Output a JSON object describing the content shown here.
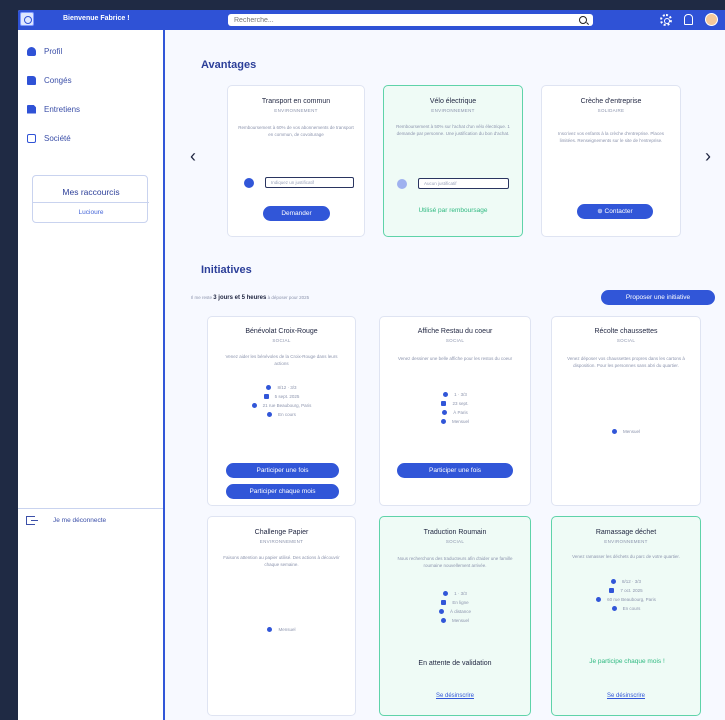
{
  "header": {
    "welcome": "Bienvenue Fabrice !",
    "search_placeholder": "Recherche...",
    "brand_color": "#2f52d6"
  },
  "sidebar": {
    "items": [
      {
        "label": "Profil",
        "icon": "user-icon"
      },
      {
        "label": "Congés",
        "icon": "calendar-icon"
      },
      {
        "label": "Entretiens",
        "icon": "document-icon"
      },
      {
        "label": "Société",
        "icon": "organization-icon"
      }
    ],
    "shortcuts_title": "Mes raccourcis",
    "shortcuts_link": "Lucioure",
    "logout": "Je me déconnecte"
  },
  "advantages": {
    "title": "Avantages",
    "cards": [
      {
        "title": "Transport en commun",
        "subtitle": "ENVIRONNEMENT",
        "desc": "Remboursement à 60% de vos abonnements de transport en commun, de covoiturage",
        "input_placeholder": "Indiquez un justificatif",
        "button": "Demander",
        "highlighted": false
      },
      {
        "title": "Vélo électrique",
        "subtitle": "ENVIRONNEMENT",
        "desc": "Remboursement à 50% sur l'achat d'un vélo électrique. 1 demande par personne. Une justification du bon d'achat.",
        "input_placeholder": "Aucun justificatif",
        "status": "Utilisé par remboursage",
        "highlighted": true
      },
      {
        "title": "Crèche d'entreprise",
        "subtitle": "SOLIDAIRE",
        "desc": "Inscrivez vos enfants à la crèche d'entreprise. Places limitées. Renseignements sur le site de l'entreprise.",
        "button": "Contacter",
        "highlighted": false
      }
    ]
  },
  "initiatives": {
    "title": "Initiatives",
    "info_prefix": "Il me reste",
    "info_bold": "3 jours et 5 heures",
    "info_suffix": "à déposer pour 2025",
    "propose_button": "Proposer une initiative",
    "cards": [
      {
        "title": "Bénévolat Croix-Rouge",
        "subtitle": "SOCIAL",
        "desc": "Venez aider les bénévoles de la Croix-Rouge dans leurs actions",
        "meta": [
          "8/12 · 3/3",
          "5 sept. 2025",
          "21 rue Beaubourg, Paris",
          "En cours"
        ],
        "buttons": [
          "Participer une fois",
          "Participer chaque mois"
        ],
        "highlighted": false
      },
      {
        "title": "Affiche Restau du coeur",
        "subtitle": "SOCIAL",
        "desc": "Venez dessiner une belle affiche pour les restos du coeur",
        "meta": [
          "1 · 3/3",
          "23 sept.",
          "À Paris",
          "Mensuel"
        ],
        "buttons": [
          "Participer une fois"
        ],
        "highlighted": false
      },
      {
        "title": "Récolte chaussettes",
        "subtitle": "SOCIAL",
        "desc": "Venez déposer vos chaussettes propres dans les cartons à disposition. Pour les personnes sans abri du quartier.",
        "meta": [
          "Mensuel"
        ],
        "buttons": [],
        "highlighted": false
      },
      {
        "title": "Challenge Papier",
        "subtitle": "ENVIRONNEMENT",
        "desc": "Faisons attention au papier utilisé. Des actions à découvrir chaque semaine.",
        "meta": [
          "Mensuel"
        ],
        "buttons": [],
        "highlighted": false
      },
      {
        "title": "Traduction Roumain",
        "subtitle": "SOCIAL",
        "desc": "Nous recherchons des traducteurs afin d'aider une famille roumaine nouvellement arrivée.",
        "meta": [
          "1 · 3/3",
          "En ligne",
          "À distance",
          "Mensuel"
        ],
        "wait": "En attente de validation",
        "link": "Se désinscrire",
        "highlighted": true
      },
      {
        "title": "Ramassage déchet",
        "subtitle": "ENVIRONNEMENT",
        "desc": "Venez ramasser les déchets du parc de votre quartier.",
        "meta": [
          "8/12 · 3/3",
          "7 oct. 2025",
          "60 rue Beaubourg, Paris",
          "En cours"
        ],
        "status": "Je participe chaque mois !",
        "link": "Se désinscrire",
        "highlighted": true
      }
    ]
  }
}
